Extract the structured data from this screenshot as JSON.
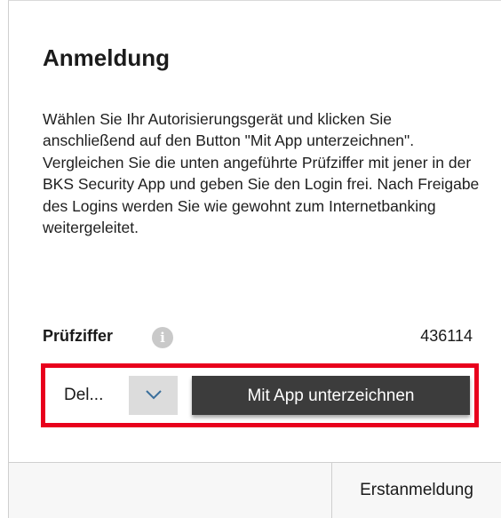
{
  "login": {
    "title": "Anmeldung",
    "description": "Wählen Sie Ihr Autorisierungsgerät und klicken Sie anschließend auf den Button \"Mit App unterzeichnen\". Vergleichen Sie die unten angeführte Prüfziffer mit jener in der BKS Security App und geben Sie den Login frei. Nach Freigabe des Logins werden Sie wie gewohnt zum Internetbanking weitergeleitet.",
    "check_code": {
      "label": "Prüfziffer",
      "info_icon": "info-icon",
      "info_glyph": "i",
      "value": "436114"
    },
    "device_select": {
      "selected": "Del...",
      "icon": "chevron-down-icon"
    },
    "sign_button_label": "Mit App unterzeichnen",
    "highlight_color": "#e8001c",
    "button_color": "#3c3c3c"
  },
  "footer": {
    "first_login_label": "Erstanmeldung"
  }
}
